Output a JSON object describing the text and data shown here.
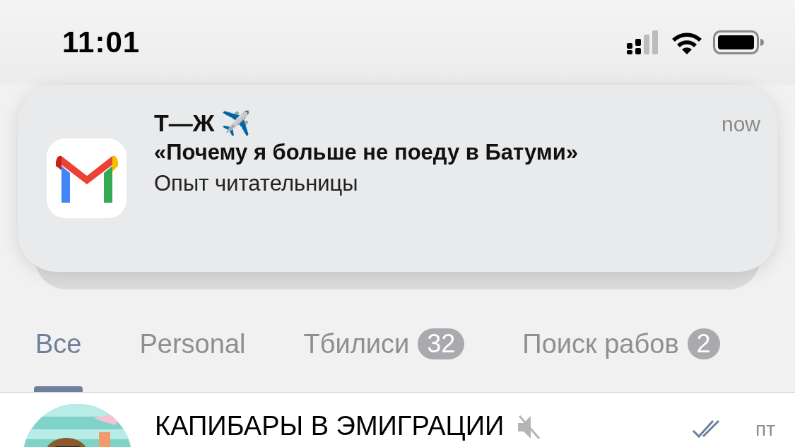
{
  "status_bar": {
    "time": "11:01"
  },
  "notification": {
    "title": "Т—Ж ✈️",
    "time": "now",
    "subject": "«Почему я больше не поеду в Батуми»",
    "body": "Опыт читательницы"
  },
  "tabs": [
    {
      "label": "Все",
      "selected": true
    },
    {
      "label": "Personal",
      "selected": false
    },
    {
      "label": "Тбилиси",
      "badge": "32",
      "selected": false
    },
    {
      "label": "Поиск рабов",
      "badge": "2",
      "selected": false
    }
  ],
  "chats": [
    {
      "title": "КАПИБАРЫ В ЭМИГРАЦИИ",
      "muted": true,
      "read": true,
      "time": "пт"
    }
  ]
}
